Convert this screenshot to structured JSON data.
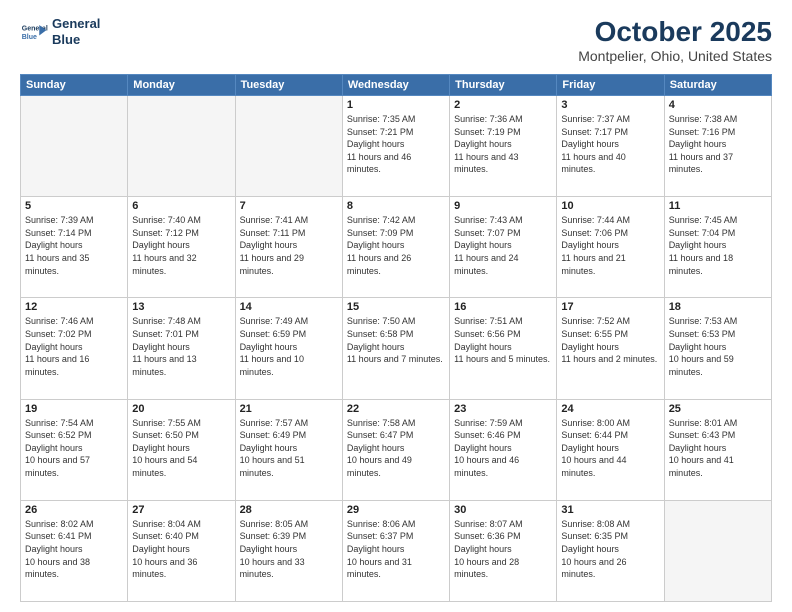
{
  "header": {
    "logo_line1": "General",
    "logo_line2": "Blue",
    "title": "October 2025",
    "subtitle": "Montpelier, Ohio, United States"
  },
  "weekdays": [
    "Sunday",
    "Monday",
    "Tuesday",
    "Wednesday",
    "Thursday",
    "Friday",
    "Saturday"
  ],
  "weeks": [
    [
      {
        "day": "",
        "empty": true
      },
      {
        "day": "",
        "empty": true
      },
      {
        "day": "",
        "empty": true
      },
      {
        "day": "1",
        "rise": "7:35 AM",
        "set": "7:21 PM",
        "daylight": "11 hours and 46 minutes."
      },
      {
        "day": "2",
        "rise": "7:36 AM",
        "set": "7:19 PM",
        "daylight": "11 hours and 43 minutes."
      },
      {
        "day": "3",
        "rise": "7:37 AM",
        "set": "7:17 PM",
        "daylight": "11 hours and 40 minutes."
      },
      {
        "day": "4",
        "rise": "7:38 AM",
        "set": "7:16 PM",
        "daylight": "11 hours and 37 minutes."
      }
    ],
    [
      {
        "day": "5",
        "rise": "7:39 AM",
        "set": "7:14 PM",
        "daylight": "11 hours and 35 minutes."
      },
      {
        "day": "6",
        "rise": "7:40 AM",
        "set": "7:12 PM",
        "daylight": "11 hours and 32 minutes."
      },
      {
        "day": "7",
        "rise": "7:41 AM",
        "set": "7:11 PM",
        "daylight": "11 hours and 29 minutes."
      },
      {
        "day": "8",
        "rise": "7:42 AM",
        "set": "7:09 PM",
        "daylight": "11 hours and 26 minutes."
      },
      {
        "day": "9",
        "rise": "7:43 AM",
        "set": "7:07 PM",
        "daylight": "11 hours and 24 minutes."
      },
      {
        "day": "10",
        "rise": "7:44 AM",
        "set": "7:06 PM",
        "daylight": "11 hours and 21 minutes."
      },
      {
        "day": "11",
        "rise": "7:45 AM",
        "set": "7:04 PM",
        "daylight": "11 hours and 18 minutes."
      }
    ],
    [
      {
        "day": "12",
        "rise": "7:46 AM",
        "set": "7:02 PM",
        "daylight": "11 hours and 16 minutes."
      },
      {
        "day": "13",
        "rise": "7:48 AM",
        "set": "7:01 PM",
        "daylight": "11 hours and 13 minutes."
      },
      {
        "day": "14",
        "rise": "7:49 AM",
        "set": "6:59 PM",
        "daylight": "11 hours and 10 minutes."
      },
      {
        "day": "15",
        "rise": "7:50 AM",
        "set": "6:58 PM",
        "daylight": "11 hours and 7 minutes."
      },
      {
        "day": "16",
        "rise": "7:51 AM",
        "set": "6:56 PM",
        "daylight": "11 hours and 5 minutes."
      },
      {
        "day": "17",
        "rise": "7:52 AM",
        "set": "6:55 PM",
        "daylight": "11 hours and 2 minutes."
      },
      {
        "day": "18",
        "rise": "7:53 AM",
        "set": "6:53 PM",
        "daylight": "10 hours and 59 minutes."
      }
    ],
    [
      {
        "day": "19",
        "rise": "7:54 AM",
        "set": "6:52 PM",
        "daylight": "10 hours and 57 minutes."
      },
      {
        "day": "20",
        "rise": "7:55 AM",
        "set": "6:50 PM",
        "daylight": "10 hours and 54 minutes."
      },
      {
        "day": "21",
        "rise": "7:57 AM",
        "set": "6:49 PM",
        "daylight": "10 hours and 51 minutes."
      },
      {
        "day": "22",
        "rise": "7:58 AM",
        "set": "6:47 PM",
        "daylight": "10 hours and 49 minutes."
      },
      {
        "day": "23",
        "rise": "7:59 AM",
        "set": "6:46 PM",
        "daylight": "10 hours and 46 minutes."
      },
      {
        "day": "24",
        "rise": "8:00 AM",
        "set": "6:44 PM",
        "daylight": "10 hours and 44 minutes."
      },
      {
        "day": "25",
        "rise": "8:01 AM",
        "set": "6:43 PM",
        "daylight": "10 hours and 41 minutes."
      }
    ],
    [
      {
        "day": "26",
        "rise": "8:02 AM",
        "set": "6:41 PM",
        "daylight": "10 hours and 38 minutes."
      },
      {
        "day": "27",
        "rise": "8:04 AM",
        "set": "6:40 PM",
        "daylight": "10 hours and 36 minutes."
      },
      {
        "day": "28",
        "rise": "8:05 AM",
        "set": "6:39 PM",
        "daylight": "10 hours and 33 minutes."
      },
      {
        "day": "29",
        "rise": "8:06 AM",
        "set": "6:37 PM",
        "daylight": "10 hours and 31 minutes."
      },
      {
        "day": "30",
        "rise": "8:07 AM",
        "set": "6:36 PM",
        "daylight": "10 hours and 28 minutes."
      },
      {
        "day": "31",
        "rise": "8:08 AM",
        "set": "6:35 PM",
        "daylight": "10 hours and 26 minutes."
      },
      {
        "day": "",
        "empty": true
      }
    ]
  ],
  "labels": {
    "sunrise": "Sunrise:",
    "sunset": "Sunset:",
    "daylight": "Daylight hours"
  }
}
